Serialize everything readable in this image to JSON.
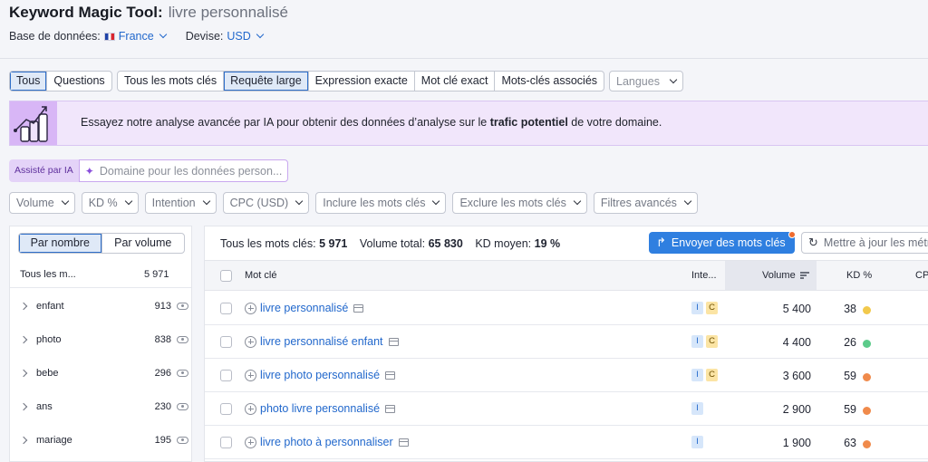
{
  "header": {
    "app_title": "Keyword Magic Tool:",
    "query": "livre personnalisé",
    "database_label": "Base de données:",
    "database_value": "France",
    "currency_label": "Devise:",
    "currency_value": "USD"
  },
  "match_tabs": {
    "group1": [
      "Tous",
      "Questions"
    ],
    "group2": [
      "Tous les mots clés",
      "Requête large",
      "Expression exacte",
      "Mot clé exact",
      "Mots-clés associés"
    ],
    "active_group1": "Tous",
    "active_group2": "Requête large",
    "languages": "Langues"
  },
  "banner": {
    "text_before": "Essayez notre analyse avancée par IA pour obtenir des données d’analyse sur le ",
    "text_bold": "trafic potentiel",
    "text_after": " de votre domaine."
  },
  "ai": {
    "tag": "Assisté par IA",
    "placeholder": "Domaine pour les données person..."
  },
  "filters": [
    "Volume",
    "KD %",
    "Intention",
    "CPC (USD)",
    "Inclure les mots clés",
    "Exclure les mots clés",
    "Filtres avancés"
  ],
  "sidebar": {
    "toggle": [
      "Par nombre",
      "Par volume"
    ],
    "active": "Par nombre",
    "header_label": "Tous les m...",
    "header_count": "5 971",
    "groups": [
      {
        "word": "enfant",
        "count": "913"
      },
      {
        "word": "photo",
        "count": "838"
      },
      {
        "word": "bebe",
        "count": "296"
      },
      {
        "word": "ans",
        "count": "230"
      },
      {
        "word": "mariage",
        "count": "195"
      }
    ]
  },
  "summary": {
    "all_label": "Tous les mots clés:",
    "all_value": "5 971",
    "volume_label": "Volume total:",
    "volume_value": "65 830",
    "kd_label": "KD moyen:",
    "kd_value": "19 %"
  },
  "actions": {
    "send": "Envoyer des mots clés",
    "update": "Mettre à jour les métriques"
  },
  "table": {
    "columns": {
      "keyword": "Mot clé",
      "intent": "Inte...",
      "volume": "Volume",
      "kd": "KD %",
      "cpc": "CPC"
    },
    "rows": [
      {
        "keyword": "livre personnalisé",
        "intents": [
          "I",
          "C"
        ],
        "volume": "5 400",
        "kd": "38",
        "kd_color": "#f2c94c"
      },
      {
        "keyword": "livre personnalisé enfant",
        "intents": [
          "I",
          "C"
        ],
        "volume": "4 400",
        "kd": "26",
        "kd_color": "#5ccb8a"
      },
      {
        "keyword": "livre photo personnalisé",
        "intents": [
          "I",
          "C"
        ],
        "volume": "3 600",
        "kd": "59",
        "kd_color": "#f08a4b"
      },
      {
        "keyword": "photo livre personnalisé",
        "intents": [
          "I"
        ],
        "volume": "2 900",
        "kd": "59",
        "kd_color": "#f08a4b"
      },
      {
        "keyword": "livre photo à personnaliser",
        "intents": [
          "I"
        ],
        "volume": "1 900",
        "kd": "63",
        "kd_color": "#f08a4b"
      }
    ]
  }
}
